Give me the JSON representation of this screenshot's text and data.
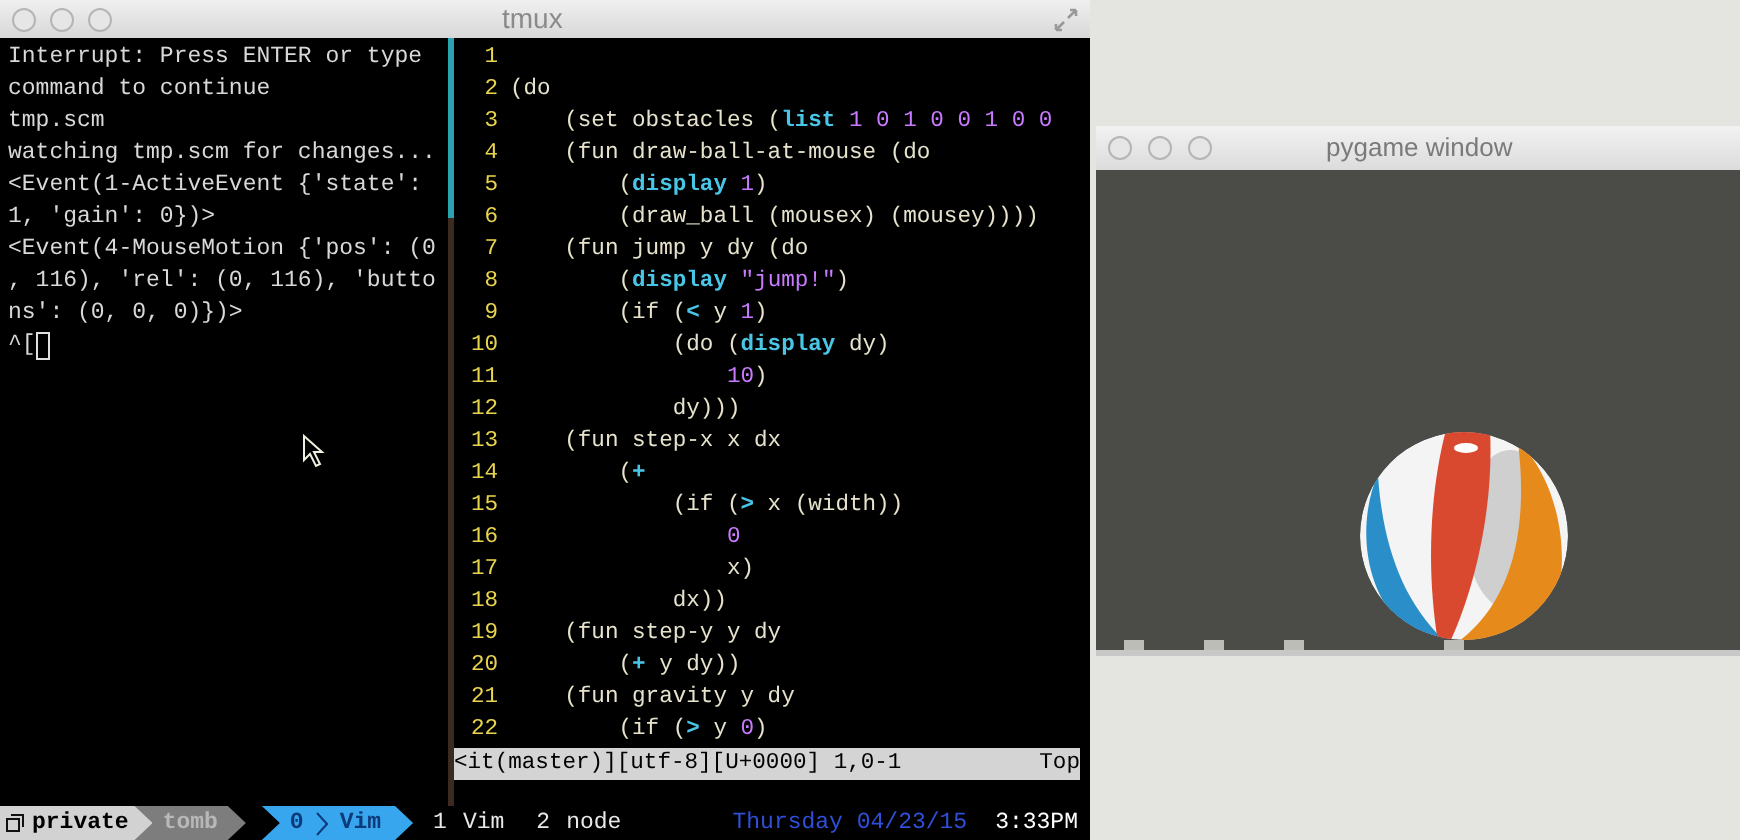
{
  "tmux_window": {
    "title": "tmux",
    "left_pane": {
      "lines": [
        "Interrupt: Press ENTER or type",
        "command to continue",
        "tmp.scm",
        "watching tmp.scm for changes...",
        "<Event(1-ActiveEvent {'state':",
        "1, 'gain': 0})>",
        "<Event(4-MouseMotion {'pos': (0",
        ", 116), 'rel': (0, 116), 'butto",
        "ns': (0, 0, 0)})>"
      ],
      "prompt": "^["
    },
    "editor": {
      "lines": [
        {
          "number": "1"
        },
        {
          "number": "2",
          "segments": [
            {
              "kind": "plain",
              "text": "(do"
            }
          ]
        },
        {
          "number": "3",
          "segments": [
            {
              "kind": "plain",
              "text": "    (set obstacles ("
            },
            {
              "kind": "keyword",
              "text": "list"
            },
            {
              "kind": "number",
              "text": " 1 0 1 0 0 1 0 0"
            }
          ]
        },
        {
          "number": "4",
          "segments": [
            {
              "kind": "plain",
              "text": "    (fun draw-ball-at-mouse (do"
            }
          ]
        },
        {
          "number": "5",
          "segments": [
            {
              "kind": "plain",
              "text": "        ("
            },
            {
              "kind": "keyword",
              "text": "display"
            },
            {
              "kind": "number",
              "text": " 1"
            },
            {
              "kind": "plain",
              "text": ")"
            }
          ]
        },
        {
          "number": "6",
          "segments": [
            {
              "kind": "plain",
              "text": "        (draw_ball (mousex) (mousey))))"
            }
          ]
        },
        {
          "number": "7",
          "segments": [
            {
              "kind": "plain",
              "text": "    (fun jump y dy (do"
            }
          ]
        },
        {
          "number": "8",
          "segments": [
            {
              "kind": "plain",
              "text": "        ("
            },
            {
              "kind": "keyword",
              "text": "display"
            },
            {
              "kind": "string",
              "text": " \"jump!\""
            },
            {
              "kind": "plain",
              "text": ")"
            }
          ]
        },
        {
          "number": "9",
          "segments": [
            {
              "kind": "plain",
              "text": "        (if ("
            },
            {
              "kind": "keyword",
              "text": "<"
            },
            {
              "kind": "plain",
              "text": " y "
            },
            {
              "kind": "number",
              "text": "1"
            },
            {
              "kind": "plain",
              "text": ")"
            }
          ]
        },
        {
          "number": "10",
          "segments": [
            {
              "kind": "plain",
              "text": "            (do ("
            },
            {
              "kind": "keyword",
              "text": "display"
            },
            {
              "kind": "plain",
              "text": " dy)"
            }
          ]
        },
        {
          "number": "11",
          "segments": [
            {
              "kind": "number",
              "text": "                10"
            },
            {
              "kind": "plain",
              "text": ")"
            }
          ]
        },
        {
          "number": "12",
          "segments": [
            {
              "kind": "plain",
              "text": "            dy)))"
            }
          ]
        },
        {
          "number": "13",
          "segments": [
            {
              "kind": "plain",
              "text": "    (fun step-x x dx"
            }
          ]
        },
        {
          "number": "14",
          "segments": [
            {
              "kind": "plain",
              "text": "        ("
            },
            {
              "kind": "keyword",
              "text": "+"
            }
          ]
        },
        {
          "number": "15",
          "segments": [
            {
              "kind": "plain",
              "text": "            (if ("
            },
            {
              "kind": "keyword",
              "text": ">"
            },
            {
              "kind": "plain",
              "text": " x (width))"
            }
          ]
        },
        {
          "number": "16",
          "segments": [
            {
              "kind": "number",
              "text": "                0"
            }
          ]
        },
        {
          "number": "17",
          "segments": [
            {
              "kind": "plain",
              "text": "                x)"
            }
          ]
        },
        {
          "number": "18",
          "segments": [
            {
              "kind": "plain",
              "text": "            dx))"
            }
          ]
        },
        {
          "number": "19",
          "segments": [
            {
              "kind": "plain",
              "text": "    (fun step-y y dy"
            }
          ]
        },
        {
          "number": "20",
          "segments": [
            {
              "kind": "plain",
              "text": "        ("
            },
            {
              "kind": "keyword",
              "text": "+"
            },
            {
              "kind": "plain",
              "text": " y dy))"
            }
          ]
        },
        {
          "number": "21",
          "segments": [
            {
              "kind": "plain",
              "text": "    (fun gravity y dy"
            }
          ]
        },
        {
          "number": "22",
          "segments": [
            {
              "kind": "plain",
              "text": "        (if ("
            },
            {
              "kind": "keyword",
              "text": ">"
            },
            {
              "kind": "plain",
              "text": " y "
            },
            {
              "kind": "number",
              "text": "0"
            },
            {
              "kind": "plain",
              "text": ")"
            }
          ]
        }
      ],
      "statusline": {
        "left": "<it(master)][utf-8][U+0000] 1,0-1",
        "right": "Top"
      }
    },
    "status_bar": {
      "session": "private",
      "label": "tomb",
      "windows": [
        {
          "index": "0",
          "name": "Vim",
          "selected": true
        },
        {
          "index": "1",
          "name": "Vim",
          "selected": false
        },
        {
          "index": "2",
          "name": "node",
          "selected": false
        }
      ],
      "date": "Thursday 04/23/15",
      "time": "3:33PM"
    }
  },
  "pygame_window": {
    "title": "pygame window"
  }
}
